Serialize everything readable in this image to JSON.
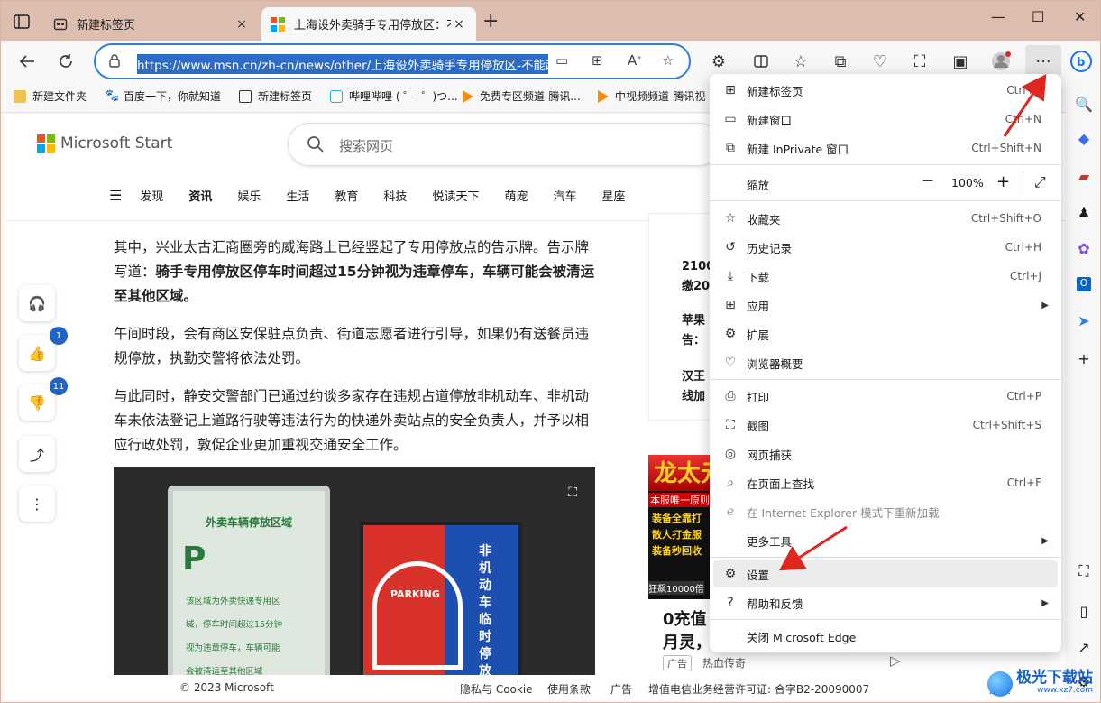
{
  "tabs": [
    {
      "title": "新建标签页",
      "close": "×"
    },
    {
      "title": "上海设外卖骑手专用停放区：不能超",
      "close": "×"
    }
  ],
  "new_tab": "+",
  "window_controls": {
    "minimize": "—",
    "maximize": "☐",
    "close": "✕"
  },
  "address_bar": {
    "url": "https://www.msn.cn/zh-cn/news/other/上海设外卖骑手专用停放区-不能超"
  },
  "bookmarks": [
    {
      "label": "新建文件夹",
      "icon": "folder-icon"
    },
    {
      "label": "百度一下，你就知道",
      "icon": "baidu-icon"
    },
    {
      "label": "新建标签页",
      "icon": "newtab-icon"
    },
    {
      "label": "哔哩哔哩 ( ゜- ゜)つ...",
      "icon": "bilibili-icon"
    },
    {
      "label": "免费专区频道-腾讯...",
      "icon": "tencent-video-icon"
    },
    {
      "label": "中视频频道-腾讯视",
      "icon": "tencent-video-icon"
    }
  ],
  "site": {
    "brand": "Microsoft Start",
    "search_placeholder": "搜索网页",
    "nav": [
      "发现",
      "资讯",
      "娱乐",
      "生活",
      "教育",
      "科技",
      "悦读天下",
      "萌宠",
      "汽车",
      "星座"
    ],
    "article": {
      "p1a": "其中，兴业太古汇商圈旁的威海路上已经竖起了专用停放点的告示牌。告示牌写道：",
      "p1b": "骑手专用停放区停车时间超过15分钟视为违章停车，车辆可能会被清运至其他区域。",
      "p2": "午间时段，会有商区安保驻点负责、街道志愿者进行引导，如果仍有送餐员违规停放，执勤交警将依法处罚。",
      "p3": "与此同时，静安交警部门已通过约谈多家存在违规占道停放非机动车、非机动车未依法登记上道路行驶等违法行为的快递外卖站点的安全负责人，并予以相应行政处罚，敦促企业更加重视交通安全工作。"
    },
    "photo_signs": {
      "left_title": "外卖车辆停放区域",
      "left_text": [
        "该区域为外卖快递专用区",
        "域，停车时间超过15分钟",
        "视为违章停车，车辆可能",
        "会被清运至其他区域"
      ],
      "right_text": "非机动车临时停放",
      "parking": "PARKING",
      "p": "P"
    },
    "likes": "1",
    "dislikes": "11",
    "right_news": [
      {
        "l1": "2100",
        "l2": "缴20"
      },
      {
        "l1": "苹果",
        "l2": "告："
      },
      {
        "l1": "汉王",
        "l2": "线加"
      }
    ],
    "ad": {
      "title1": "0充值",
      "title2": "月灵，",
      "tag": "广告",
      "source": "热血传奇",
      "banner": "本服唯一原则",
      "lines": [
        "装备全靠打",
        "散人打金服",
        "装备秒回收"
      ],
      "bottom": "狂飙10000倍",
      "big": "龙太元"
    },
    "footer": {
      "copyright": "© 2023 Microsoft",
      "privacy": "隐私与 Cookie",
      "terms": "使用条款",
      "ads": "广告",
      "license": "增值电信业务经营许可证: 合字B2-20090007",
      "feedback": "反馈"
    }
  },
  "menu": {
    "items": [
      {
        "label": "新建标签页",
        "shortcut": "Ctrl+T",
        "icon": "new-tab-icon"
      },
      {
        "label": "新建窗口",
        "shortcut": "Ctrl+N",
        "icon": "new-window-icon"
      },
      {
        "label": "新建 InPrivate 窗口",
        "shortcut": "Ctrl+Shift+N",
        "icon": "inprivate-icon"
      },
      {
        "label": "缩放",
        "icon": "zoom"
      },
      {
        "label": "收藏夹",
        "shortcut": "Ctrl+Shift+O",
        "icon": "favorites-icon"
      },
      {
        "label": "历史记录",
        "shortcut": "Ctrl+H",
        "icon": "history-icon"
      },
      {
        "label": "下载",
        "shortcut": "Ctrl+J",
        "icon": "download-icon"
      },
      {
        "label": "应用",
        "icon": "apps-icon"
      },
      {
        "label": "扩展",
        "icon": "extensions-icon"
      },
      {
        "label": "浏览器概要",
        "icon": "browser-essentials-icon"
      },
      {
        "label": "打印",
        "shortcut": "Ctrl+P",
        "icon": "print-icon"
      },
      {
        "label": "截图",
        "shortcut": "Ctrl+Shift+S",
        "icon": "screenshot-icon"
      },
      {
        "label": "网页捕获",
        "icon": "web-capture-icon"
      },
      {
        "label": "在页面上查找",
        "shortcut": "Ctrl+F",
        "icon": "find-icon"
      },
      {
        "label": "在 Internet Explorer 模式下重新加载",
        "icon": "ie-icon"
      },
      {
        "label": "更多工具",
        "icon": "more-tools"
      },
      {
        "label": "设置",
        "icon": "settings-icon"
      },
      {
        "label": "帮助和反馈",
        "icon": "help-icon"
      },
      {
        "label": "关闭 Microsoft Edge",
        "icon": "none"
      }
    ],
    "zoom_value": "100%",
    "zoom_minus": "—",
    "zoom_plus": "+"
  },
  "watermark": {
    "text": "极光下载站",
    "sub": "www.xz7.com"
  },
  "colors": {
    "accent": "#2f7fd9",
    "tabbar": "#ddbdb0",
    "arrow": "#e0261f",
    "badge": "#1f63c7"
  }
}
